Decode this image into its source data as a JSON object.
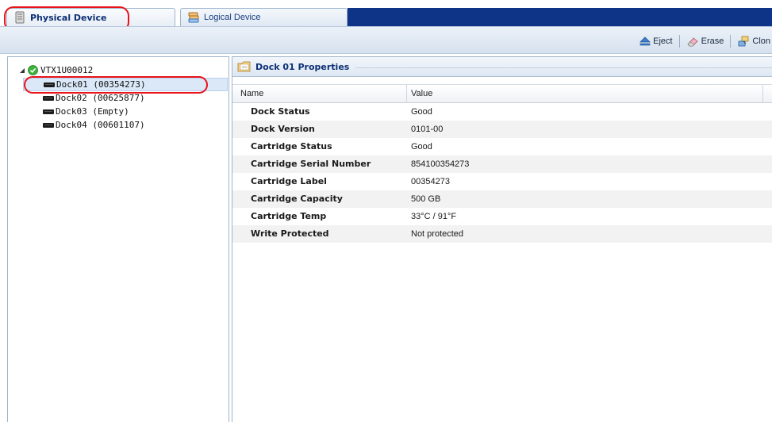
{
  "tabs": {
    "physical": {
      "label": "Physical Device",
      "icon": "server-icon"
    },
    "logical": {
      "label": "Logical Device",
      "icon": "disk-stack-icon"
    }
  },
  "toolbar": {
    "eject_label": "Eject",
    "erase_label": "Erase",
    "clone_label": "Clon"
  },
  "tree": {
    "root": {
      "label": "VTX1U00012",
      "status": "ok"
    },
    "docks": [
      {
        "label": "Dock01 (00354273)",
        "selected": true
      },
      {
        "label": "Dock02 (00625877)",
        "selected": false
      },
      {
        "label": "Dock03 (Empty)",
        "selected": false
      },
      {
        "label": "Dock04 (00601107)",
        "selected": false
      }
    ]
  },
  "properties": {
    "title": "Dock 01 Properties",
    "columns": {
      "name": "Name",
      "value": "Value"
    },
    "rows": [
      {
        "name": "Dock Status",
        "value": "Good"
      },
      {
        "name": "Dock Version",
        "value": "0101-00"
      },
      {
        "name": "Cartridge Status",
        "value": "Good"
      },
      {
        "name": "Cartridge Serial Number",
        "value": "854100354273"
      },
      {
        "name": "Cartridge Label",
        "value": "00354273"
      },
      {
        "name": "Cartridge Capacity",
        "value": "500 GB"
      },
      {
        "name": "Cartridge Temp",
        "value": "33°C / 91°F"
      },
      {
        "name": "Write Protected",
        "value": "Not protected"
      }
    ]
  },
  "colors": {
    "accent_navy": "#0e3488",
    "highlight_red": "#e8141a",
    "status_green": "#3bb33b"
  }
}
